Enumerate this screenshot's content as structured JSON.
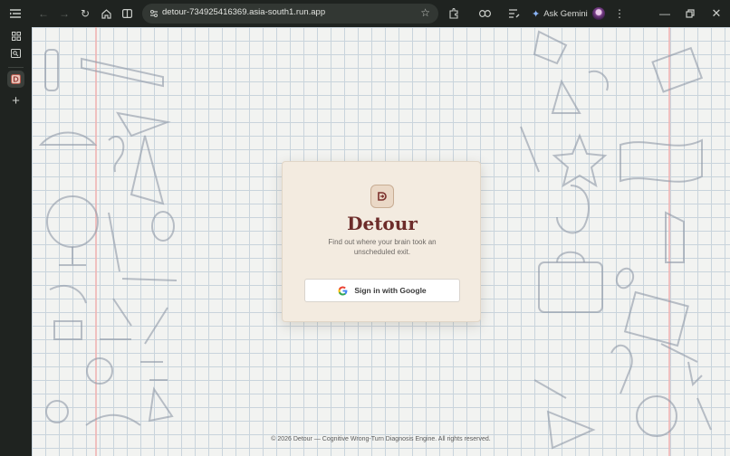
{
  "browser": {
    "url": "detour-734925416369.asia-south1.run.app",
    "gemini_label": "Ask Gemini",
    "icons": [
      "menu-icon",
      "back-icon",
      "forward-icon",
      "reload-icon",
      "home-icon",
      "split-view-icon",
      "site-info-icon",
      "star-icon",
      "extensions-icon",
      "link-icon",
      "reading-list-icon",
      "gemini-icon",
      "profile-avatar",
      "more-menu-icon",
      "minimize-icon",
      "restore-icon",
      "close-icon"
    ]
  },
  "sidebar": {
    "items": [
      "tab-grid-icon",
      "search-tabs-icon",
      "detour-tab-icon",
      "new-tab-icon"
    ]
  },
  "card": {
    "title": "Detour",
    "subtitle": "Find out where your brain took an unscheduled exit.",
    "signin_label": "Sign in with Google"
  },
  "footer": {
    "text": "© 2026 Detour — Cognitive Wrong-Turn Diagnosis Engine. All rights reserved."
  },
  "colors": {
    "brand": "#6d2c2a",
    "card_bg": "#f3ebe0",
    "chrome_bg": "#1f2320"
  }
}
